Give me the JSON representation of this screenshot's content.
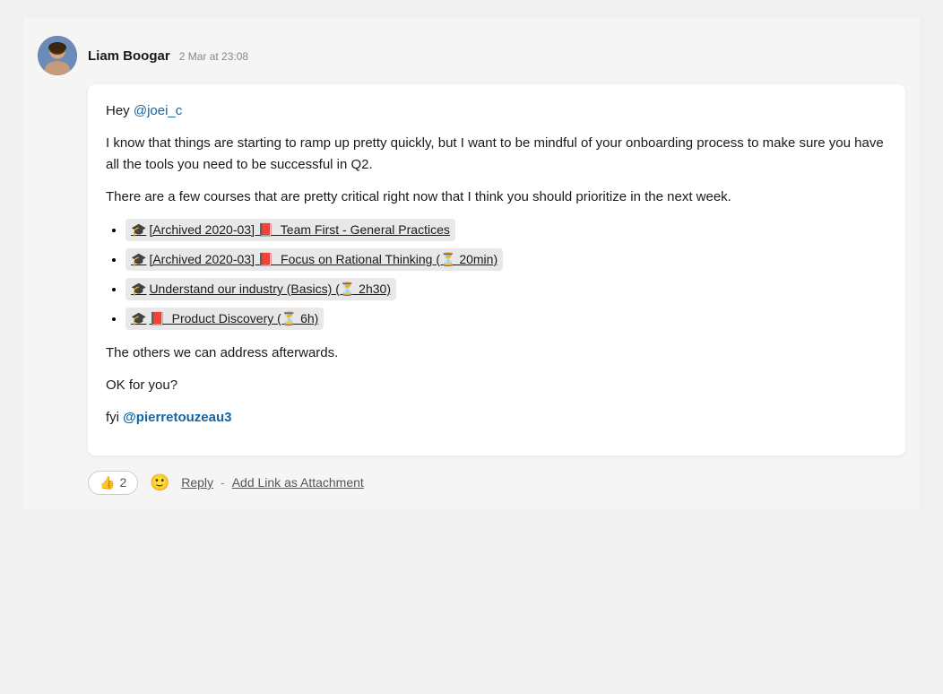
{
  "author": {
    "name": "Liam Boogar",
    "timestamp": "2 Mar at 23:08"
  },
  "message": {
    "greeting": "Hey ",
    "mention1": "@joei_c",
    "paragraph1": "I know that things are starting to ramp up pretty quickly, but I want to be mindful of your onboarding process to make sure you have all the tools you need to be successful in Q2.",
    "paragraph2": "There are a few courses that are pretty critical right now that I think you should prioritize in the next week.",
    "courses": [
      {
        "icon_left": "🎓",
        "text": "[Archived 2020-03] 📕  Team First - General Practices"
      },
      {
        "icon_left": "🎓",
        "text": "[Archived 2020-03] 📕  Focus on Rational Thinking (⏳ 20min)"
      },
      {
        "icon_left": "🎓",
        "text": "Understand our industry (Basics) (⏳ 2h30)"
      },
      {
        "icon_left": "🎓",
        "text": "📕  Product Discovery (⏳ 6h)"
      }
    ],
    "paragraph3": "The others we can address afterwards.",
    "paragraph4": "OK for you?",
    "fyi_text": "fyi ",
    "mention2": "@pierretouzeau3"
  },
  "actions": {
    "reaction_emoji": "👍",
    "reaction_count": "2",
    "emoji_reaction_btn_label": "Add emoji reaction",
    "reply_label": "Reply",
    "separator": "-",
    "add_link_label": "Add Link as Attachment"
  }
}
